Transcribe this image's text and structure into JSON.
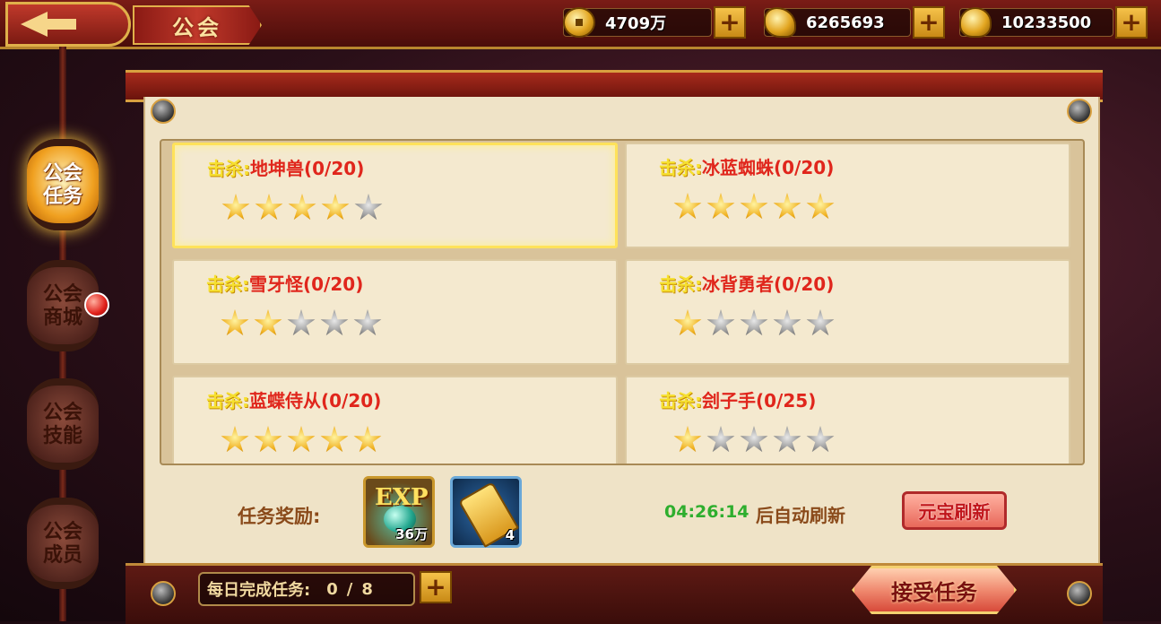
{
  "header": {
    "title": "公会",
    "resources": [
      {
        "icon": "copper-coin-icon",
        "value": "4709万"
      },
      {
        "icon": "gold-ingot-icon",
        "value": "6265693"
      },
      {
        "icon": "yuanbao-icon",
        "value": "10233500"
      }
    ]
  },
  "sidebar": {
    "items": [
      {
        "label": "公会任务",
        "active": true
      },
      {
        "label": "公会商城",
        "active": false,
        "notification": true
      },
      {
        "label": "公会技能",
        "active": false
      },
      {
        "label": "公会成员",
        "active": false
      }
    ]
  },
  "tasks": {
    "kill_label": "击杀:",
    "items": [
      {
        "target": "地坤兽(0/20)",
        "stars": 4,
        "selected": true
      },
      {
        "target": "冰蓝蜘蛛(0/20)",
        "stars": 5,
        "selected": false
      },
      {
        "target": "雪牙怪(0/20)",
        "stars": 2,
        "selected": false
      },
      {
        "target": "冰背勇者(0/20)",
        "stars": 1,
        "selected": false
      },
      {
        "target": "蓝蝶侍从(0/20)",
        "stars": 5,
        "selected": false
      },
      {
        "target": "刽子手(0/25)",
        "stars": 1,
        "selected": false
      }
    ],
    "max_stars": 5
  },
  "reward": {
    "label": "任务奖励:",
    "items": [
      {
        "icon": "exp-potion-icon",
        "text": "EXP",
        "count": "36万"
      },
      {
        "icon": "guild-token-icon",
        "count": "4"
      }
    ]
  },
  "refresh": {
    "timer": "04:26:14",
    "suffix": "后自动刷新",
    "button_label": "元宝刷新"
  },
  "daily": {
    "label": "每日完成任务:",
    "done": "0",
    "separator": "/",
    "total": "8"
  },
  "accept_button": "接受任务",
  "colors": {
    "kill_label": "#f6e030",
    "target": "#e0261c",
    "timer": "#2eae2e",
    "panel": "#efe3c7"
  }
}
